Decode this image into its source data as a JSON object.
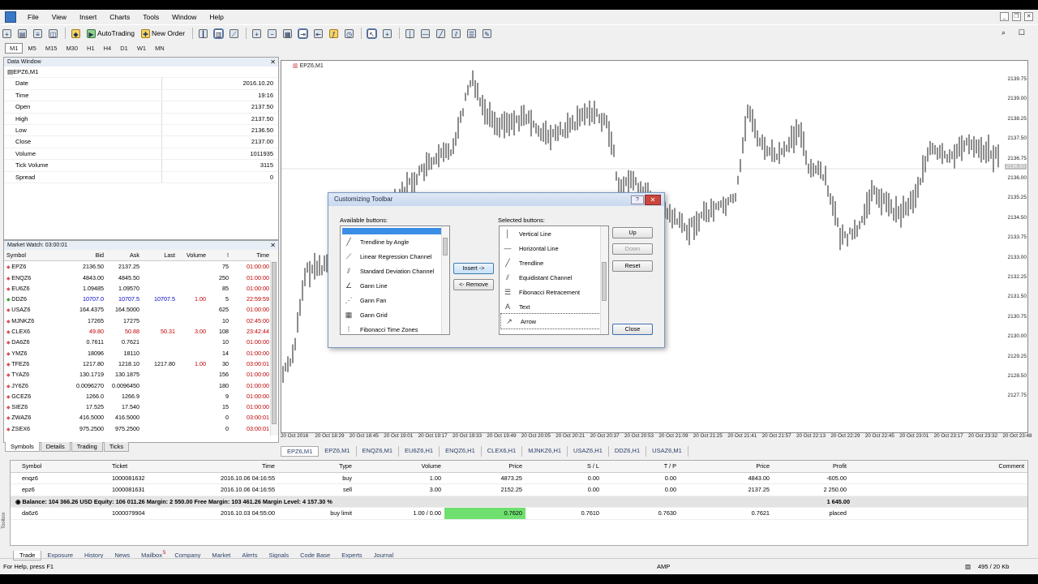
{
  "menu": [
    "File",
    "View",
    "Insert",
    "Charts",
    "Tools",
    "Window",
    "Help"
  ],
  "toolbar": {
    "autotrading": "AutoTrading",
    "new_order": "New Order"
  },
  "timeframes": [
    "M1",
    "M5",
    "M15",
    "M30",
    "H1",
    "H4",
    "D1",
    "W1",
    "MN"
  ],
  "data_window": {
    "title": "Data Window",
    "symbol": "EPZ6,M1",
    "rows": [
      {
        "k": "Date",
        "v": "2016.10.20"
      },
      {
        "k": "Time",
        "v": "19:16"
      },
      {
        "k": "Open",
        "v": "2137.50"
      },
      {
        "k": "High",
        "v": "2137.50"
      },
      {
        "k": "Low",
        "v": "2136.50"
      },
      {
        "k": "Close",
        "v": "2137.00"
      },
      {
        "k": "Volume",
        "v": "1011935"
      },
      {
        "k": "Tick Volume",
        "v": "3115"
      },
      {
        "k": "Spread",
        "v": "0"
      }
    ]
  },
  "market_watch": {
    "title": "Market Watch: 03:00:01",
    "headers": [
      "Symbol",
      "Bid",
      "Ask",
      "Last",
      "Volume",
      "!",
      "Time"
    ],
    "rows": [
      {
        "s": "EPZ6",
        "b": "2136.50",
        "a": "2137.25",
        "l": "",
        "v": "",
        "x": "75",
        "t": "01:00:00",
        "up": false
      },
      {
        "s": "ENQZ6",
        "b": "4843.00",
        "a": "4845.50",
        "l": "",
        "v": "",
        "x": "250",
        "t": "01:00:00",
        "up": false
      },
      {
        "s": "EU6Z6",
        "b": "1.09485",
        "a": "1.09570",
        "l": "",
        "v": "",
        "x": "85",
        "t": "01:00:00",
        "up": false
      },
      {
        "s": "DDZ6",
        "b": "10707.0",
        "a": "10707.5",
        "l": "10707.5",
        "v": "1.00",
        "x": "5",
        "t": "22:59:59",
        "up": true
      },
      {
        "s": "USAZ6",
        "b": "164.4375",
        "a": "164.5000",
        "l": "",
        "v": "",
        "x": "625",
        "t": "01:00:00",
        "up": false
      },
      {
        "s": "MJNKZ6",
        "b": "17265",
        "a": "17275",
        "l": "",
        "v": "",
        "x": "10",
        "t": "02:45:00",
        "up": false
      },
      {
        "s": "CLEX6",
        "b": "49.80",
        "a": "50.88",
        "l": "50.31",
        "v": "3.00",
        "x": "108",
        "t": "23:42:44",
        "up": false
      },
      {
        "s": "DA6Z6",
        "b": "0.7611",
        "a": "0.7621",
        "l": "",
        "v": "",
        "x": "10",
        "t": "01:00:00",
        "up": false
      },
      {
        "s": "YMZ6",
        "b": "18096",
        "a": "18110",
        "l": "",
        "v": "",
        "x": "14",
        "t": "01:00:00",
        "up": false
      },
      {
        "s": "TFEZ6",
        "b": "1217.80",
        "a": "1218.10",
        "l": "1217.80",
        "v": "1.00",
        "x": "30",
        "t": "03:00:01",
        "up": false
      },
      {
        "s": "TYAZ6",
        "b": "130.1719",
        "a": "130.1875",
        "l": "",
        "v": "",
        "x": "156",
        "t": "01:00:00",
        "up": false
      },
      {
        "s": "JY6Z6",
        "b": "0.0096270",
        "a": "0.0096450",
        "l": "",
        "v": "",
        "x": "180",
        "t": "01:00:00",
        "up": false
      },
      {
        "s": "GCEZ6",
        "b": "1266.0",
        "a": "1266.9",
        "l": "",
        "v": "",
        "x": "9",
        "t": "01:00:00",
        "up": false
      },
      {
        "s": "SIEZ6",
        "b": "17.525",
        "a": "17.540",
        "l": "",
        "v": "",
        "x": "15",
        "t": "01:00:00",
        "up": false
      },
      {
        "s": "ZWAZ6",
        "b": "416.5000",
        "a": "416.5000",
        "l": "",
        "v": "",
        "x": "0",
        "t": "03:00:01",
        "up": false
      },
      {
        "s": "ZSEX6",
        "b": "975.2500",
        "a": "975.2500",
        "l": "",
        "v": "",
        "x": "0",
        "t": "03:00:01",
        "up": false
      }
    ],
    "tabs": [
      "Symbols",
      "Details",
      "Trading",
      "Ticks"
    ]
  },
  "chart": {
    "title": "EPZ6,M1",
    "y_labels": [
      "2139.75",
      "2139.00",
      "2138.25",
      "2137.50",
      "2136.75",
      "2136.00",
      "2135.25",
      "2134.50",
      "2133.75",
      "2133.00",
      "2132.25",
      "2131.50",
      "2130.75",
      "2130.00",
      "2129.25",
      "2128.50",
      "2127.75"
    ],
    "current_price": "2136.50",
    "x_labels": [
      "20 Oct 2016",
      "20 Oct 18:29",
      "20 Oct 18:45",
      "20 Oct 19:01",
      "20 Oct 19:17",
      "20 Oct 19:33",
      "20 Oct 19:49",
      "20 Oct 20:05",
      "20 Oct 20:21",
      "20 Oct 20:37",
      "20 Oct 20:53",
      "20 Oct 21:09",
      "20 Oct 21:25",
      "20 Oct 21:41",
      "20 Oct 21:57",
      "20 Oct 22:13",
      "20 Oct 22:29",
      "20 Oct 22:45",
      "20 Oct 23:01",
      "20 Oct 23:17",
      "20 Oct 23:32",
      "20 Oct 23:48"
    ],
    "tabs": [
      "EPZ6,M1",
      "EPZ6,M1",
      "ENQZ6,M1",
      "EU6Z6,H1",
      "ENQZ6,H1",
      "CLEX6,H1",
      "MJNKZ6,H1",
      "USAZ6,H1",
      "DDZ6,H1",
      "USAZ6,M1"
    ],
    "active_tab": 0
  },
  "dialog": {
    "title": "Customizing Toolbar",
    "help": "?",
    "close_x": "✕",
    "available_label": "Available buttons:",
    "selected_label": "Selected buttons:",
    "available": [
      {
        "icon": "╱",
        "label": "Trendline by Angle"
      },
      {
        "icon": "⟋",
        "label": "Linear Regression Channel"
      },
      {
        "icon": "⫽",
        "label": "Standard Deviation Channel"
      },
      {
        "icon": "∠",
        "label": "Gann Line"
      },
      {
        "icon": "⋰",
        "label": "Gann Fan"
      },
      {
        "icon": "▦",
        "label": "Gann Grid"
      },
      {
        "icon": "⁞",
        "label": "Fibonacci Time Zones"
      }
    ],
    "selected": [
      {
        "icon": "│",
        "label": "Vertical Line"
      },
      {
        "icon": "—",
        "label": "Horizontal Line"
      },
      {
        "icon": "╱",
        "label": "Trendline"
      },
      {
        "icon": "⫽",
        "label": "Equidistant Channel"
      },
      {
        "icon": "☰",
        "label": "Fibonacci Retracement"
      },
      {
        "icon": "A",
        "label": "Text"
      },
      {
        "icon": "↗",
        "label": "Arrow"
      }
    ],
    "buttons": {
      "insert": "Insert ->",
      "remove": "<- Remove",
      "up": "Up",
      "down": "Down",
      "reset": "Reset",
      "close": "Close"
    }
  },
  "terminal": {
    "headers": {
      "sym": "Symbol",
      "tk": "Ticket",
      "time": "Time",
      "type": "Type",
      "vol": "Volume",
      "pr": "Price",
      "sl": "S / L",
      "tp": "T / P",
      "p2": "Price",
      "pf": "Profit",
      "cm": "Comment"
    },
    "rows": [
      {
        "sym": "enqz6",
        "tk": "1000081632",
        "time": "2016.10.06 04:16:55",
        "type": "buy",
        "vol": "1.00",
        "pr": "4873.25",
        "sl": "0.00",
        "tp": "0.00",
        "p2": "4843.00",
        "pf": "-605.00",
        "cm": ""
      },
      {
        "sym": "epz6",
        "tk": "1000081631",
        "time": "2016.10.06 04:16:55",
        "type": "sell",
        "vol": "3.00",
        "pr": "2152.25",
        "sl": "0.00",
        "tp": "0.00",
        "p2": "2137.25",
        "pf": "2 250.00",
        "cm": ""
      }
    ],
    "balance": "Balance: 104 366.26 USD  Equity: 106 011.26  Margin: 2 550.00  Free Margin: 103 461.26  Margin Level: 4 157.30 %",
    "balance_profit": "1 645.00",
    "pending": {
      "sym": "da6z6",
      "tk": "1000079904",
      "time": "2016.10.03 04:55:00",
      "type": "buy limit",
      "vol": "1.00 / 0.00",
      "pr": "0.7620",
      "sl": "0.7610",
      "tp": "0.7630",
      "p2": "0.7621",
      "pf": "placed",
      "cm": ""
    },
    "tabs": [
      "Trade",
      "Exposure",
      "History",
      "News",
      "Mailbox",
      "Company",
      "Market",
      "Alerts",
      "Signals",
      "Code Base",
      "Experts",
      "Journal"
    ],
    "mailbox_count": "5",
    "toolbox": "Toolbox"
  },
  "status": {
    "help": "For Help, press F1",
    "profile": "AMP",
    "traffic": "495 / 20 Kb"
  }
}
